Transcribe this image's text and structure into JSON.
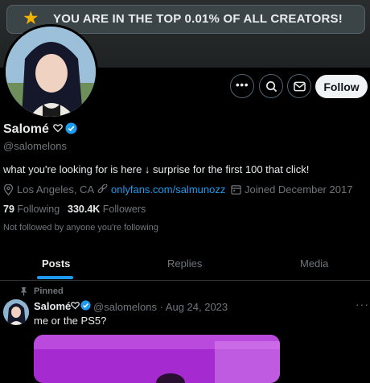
{
  "banner": {
    "achievement_text": "YOU ARE IN THE TOP 0.01% OF ALL CREATORS!"
  },
  "actions": {
    "follow_label": "Follow"
  },
  "profile": {
    "name": "Salomé",
    "handle": "@salomelons",
    "bio": "what you're looking for is here ↓ surprise for the first 100 that click!",
    "location": "Los Angeles, CA",
    "link": "onlyfans.com/salmunozz",
    "joined": "Joined December 2017",
    "following_count": "79",
    "following_label": "Following",
    "followers_count": "330.4K",
    "followers_label": "Followers",
    "not_followed": "Not followed by anyone you're following"
  },
  "tabs": [
    {
      "label": "Posts",
      "active": true
    },
    {
      "label": "Replies",
      "active": false
    },
    {
      "label": "Media",
      "active": false
    }
  ],
  "post": {
    "pinned_label": "Pinned",
    "author": "Salomé",
    "handle_date": "@salomelons · Aug 24, 2023",
    "text": "me or the PS5?",
    "more": "···"
  },
  "colors": {
    "accent": "#1d9bf0",
    "background": "#000000",
    "muted": "#71767b",
    "star": "#f5b301"
  }
}
